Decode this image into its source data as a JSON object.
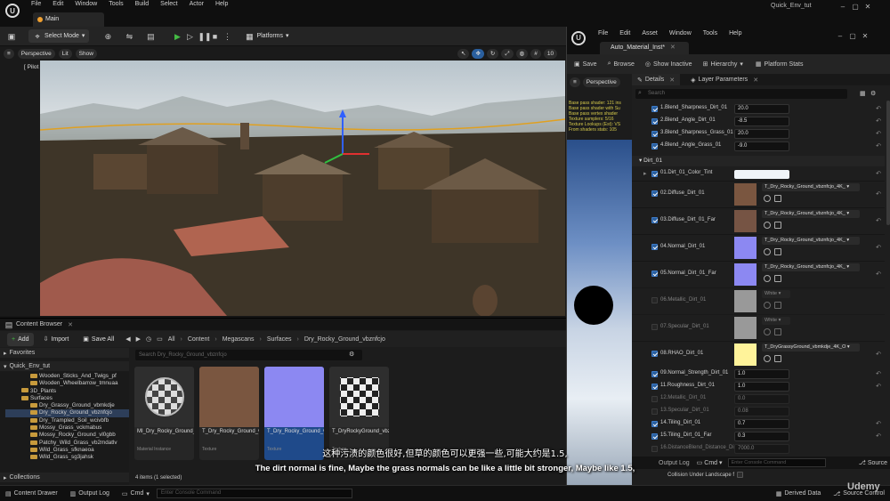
{
  "app": {
    "project_title": "Quick_Env_tut",
    "menu": [
      "File",
      "Edit",
      "Window",
      "Tools",
      "Build",
      "Select",
      "Actor",
      "Help"
    ],
    "tab": "Main"
  },
  "toolbar": {
    "select_mode": "Select Mode",
    "platforms": "Platforms"
  },
  "viewport": {
    "perspective": "Perspective",
    "lit": "Lit",
    "show": "Show",
    "pilot": "[ Pilot Active - CameraActor3 ]",
    "grid_value": "10"
  },
  "content_browser": {
    "title": "Content Browser",
    "add": "Add",
    "import": "Import",
    "save_all": "Save All",
    "breadcrumb": [
      "All",
      "Content",
      "Megascans",
      "Surfaces",
      "Dry_Rocky_Ground_vbznfcjo"
    ],
    "favorites": "Favorites",
    "project": "Quick_Env_tut",
    "collections": "Collections",
    "search_placeholder": "Search Dry_Rocky_Ground_vbznfcjo",
    "tree": [
      "Wooden_Sticks_And_Twigs_pf",
      "Wooden_Wheelbarrow_tmnuaa",
      "3D_Plants",
      "Surfaces",
      "Dry_Grassy_Ground_vbmkdje",
      "Dry_Rocky_Ground_vbznfcjo",
      "Dry_Trampled_Soil_wcivbfb",
      "Mossy_Grass_vckmabus",
      "Mossy_Rocky_Ground_vl0gbb",
      "Patchy_Wild_Grass_vb2mdatlv",
      "Wild_Grass_sfknaeoa",
      "Wild_Grass_sg3jahsk"
    ],
    "assets": [
      {
        "name": "MI_Dry_Rocky_Ground_vbznfcjo_4K",
        "type": "Material Instance"
      },
      {
        "name": "T_Dry_Rocky_Ground_vbznfcjo_4K_D",
        "type": "Texture"
      },
      {
        "name": "T_Dry_Rocky_Ground_vbznfcjo_4K_N",
        "type": "Texture"
      },
      {
        "name": "T_DryRockyGround_vbznfcjo_4K_OROp",
        "type": "Texture"
      }
    ],
    "status": "4 items (1 selected)"
  },
  "bottom_bar": {
    "content_drawer": "Content Drawer",
    "output_log": "Output Log",
    "cmd": "Cmd",
    "console_placeholder": "Enter Console Command",
    "derived_data": "Derived Data",
    "source_control": "Source Control"
  },
  "material_editor": {
    "tab": "Auto_Material_Inst*",
    "menu": [
      "File",
      "Edit",
      "Asset",
      "Window",
      "Tools",
      "Help"
    ],
    "save": "Save",
    "browse": "Browse",
    "show_inactive": "Show Inactive",
    "hierarchy": "Hierarchy",
    "platform_stats": "Platform Stats",
    "perspective": "Perspective",
    "details_tab": "Details",
    "layer_params_tab": "Layer Parameters",
    "search_placeholder": "Search",
    "stats_lines": [
      "Base pass shader: 121 ins",
      "Base pass shader with Su",
      "Base pass vertex shader",
      "Texture samplers: 5/16",
      "Texture Lookups (Est): VS",
      "From shaders stats: 105"
    ],
    "params_top": [
      {
        "name": "1.Blend_Sharpness_Dirt_01",
        "value": "20.0",
        "on": true
      },
      {
        "name": "2.Blend_Angle_Dirt_01",
        "value": "-8.5",
        "on": true
      },
      {
        "name": "3.Blend_Sharpness_Grass_01",
        "value": "20.0",
        "on": true
      },
      {
        "name": "4.Blend_Angle_Grass_01",
        "value": "-9.0",
        "on": true
      }
    ],
    "group": "Dirt_01",
    "color_tint": "01.Dirt_01_Color_Tint",
    "textures": [
      {
        "name": "02.Diffuse_Dirt_01",
        "tex": "T_Dry_Rocky_Ground_vbznfcjo_4K_",
        "color": "#7a5640",
        "on": true
      },
      {
        "name": "03.Diffuse_Dirt_01_Far",
        "tex": "T_Dry_Rocky_Ground_vbznfcjo_4K_",
        "color": "#765444",
        "on": true
      },
      {
        "name": "04.Normal_Dirt_01",
        "tex": "T_Dry_Rocky_Ground_vbznfcjo_4K_",
        "color": "#8c88f2",
        "on": true
      },
      {
        "name": "05.Normal_Dirt_01_Far",
        "tex": "T_Dry_Rocky_Ground_vbznfcjo_4K_",
        "color": "#8c88f2",
        "on": true
      },
      {
        "name": "06.Metallic_Dirt_01",
        "tex": "White",
        "color": "#ffffff",
        "on": false
      },
      {
        "name": "07.Specular_Dirt_01",
        "tex": "White",
        "color": "#ffffff",
        "on": false
      },
      {
        "name": "08.RHAO_Dirt_01",
        "tex": "T_DryGrassyGround_vbmkdje_4K_O",
        "color": "#fff39a",
        "on": true
      }
    ],
    "params_bottom": [
      {
        "name": "09.Normal_Strength_Dirt_01",
        "value": "1.0",
        "on": true
      },
      {
        "name": "11.Roughness_Dirt_01",
        "value": "1.0",
        "on": true
      },
      {
        "name": "12.Metallic_Dirt_01",
        "value": "0.0",
        "on": false
      },
      {
        "name": "13.Specular_Dirt_01",
        "value": "0.08",
        "on": false
      },
      {
        "name": "14.Tiling_Dirt_01",
        "value": "0.7",
        "on": true
      },
      {
        "name": "15.Tiling_Dirt_01_Far",
        "value": "0.3",
        "on": true
      },
      {
        "name": "16.DistanceBlend_Distance_Dirt",
        "value": "7000.0",
        "on": false
      }
    ],
    "output_log": "Output Log",
    "cmd": "Cmd",
    "console_placeholder": "Enter Console Command",
    "source": "Source",
    "collision_text": "Collision Under Landscape f"
  },
  "subtitles": {
    "cn": "这种污渍的颜色很好,但草的颜色可以更强一些,可能大约是1.5,",
    "en": "The dirt normal is fine, Maybe the grass normals can be like a little bit stronger, Maybe like 1.5,"
  },
  "watermark": "Udemy",
  "colors": {
    "accent_blue": "#2a5f9e",
    "play_green": "#44bb44",
    "folder_yellow": "#c79a3c",
    "selection": "#2d3e59"
  }
}
